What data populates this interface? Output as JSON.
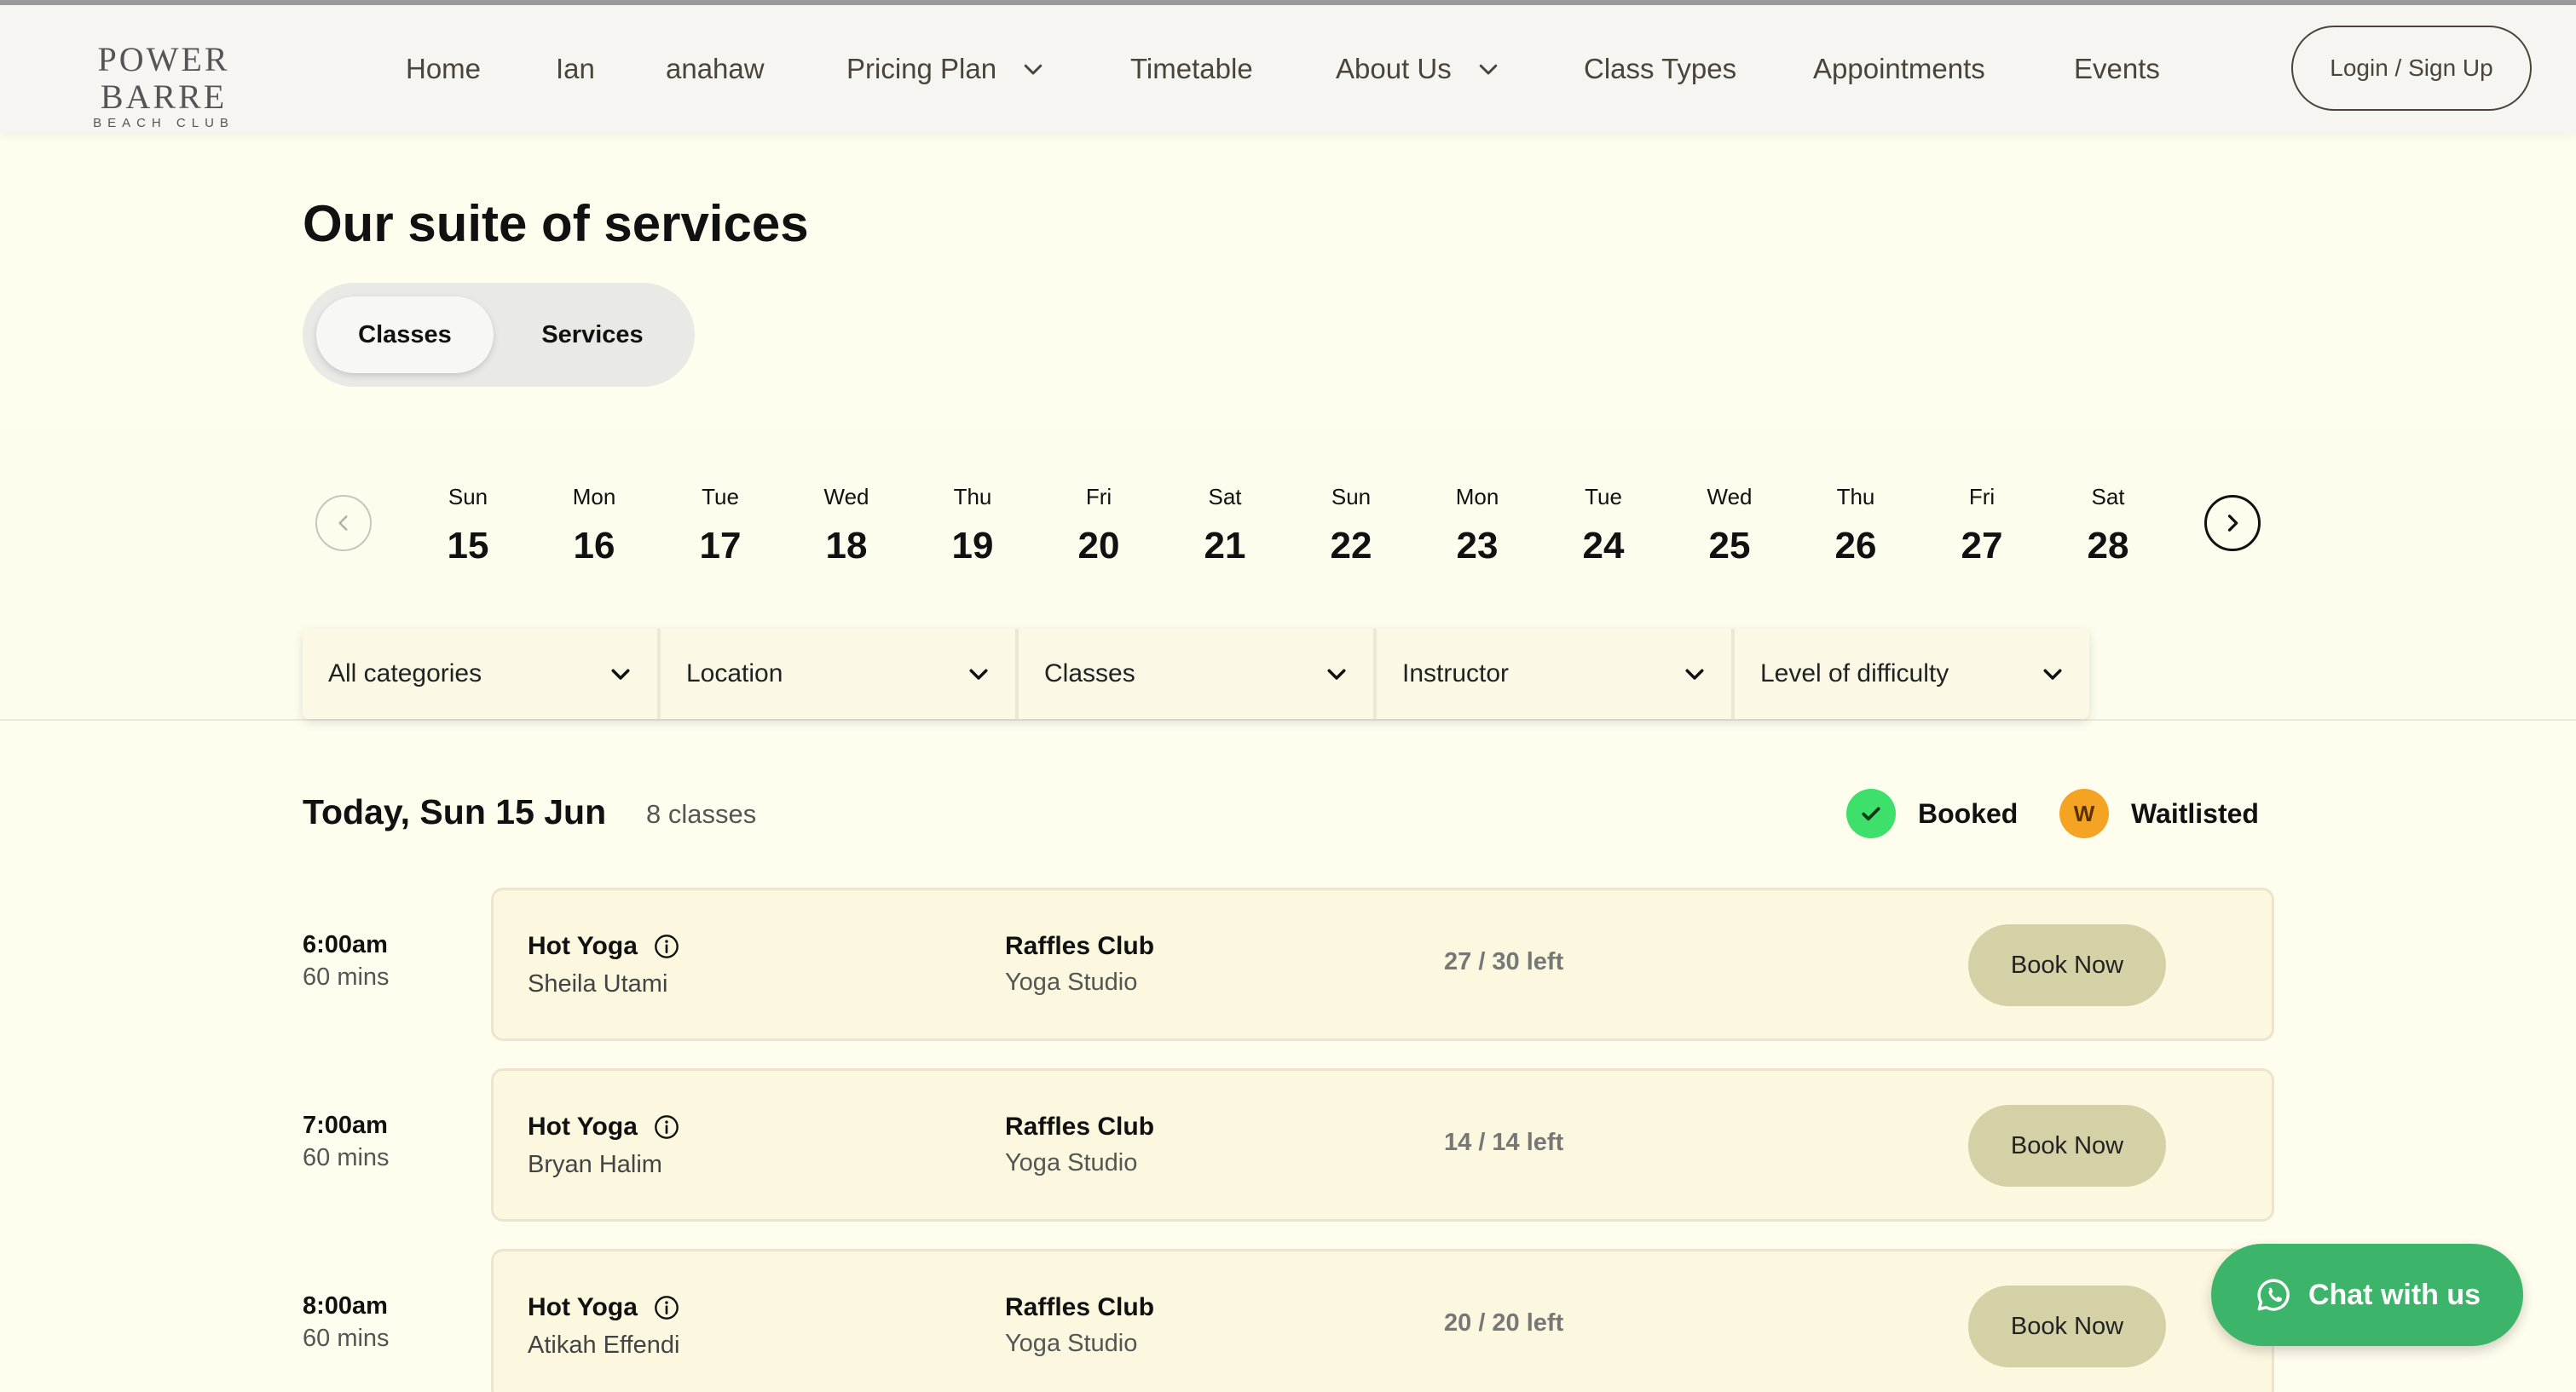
{
  "header": {
    "logo_main": "POWER BARRE",
    "logo_sub": "BEACH CLUB",
    "nav": [
      {
        "label": "Home",
        "dropdown": false
      },
      {
        "label": "Ian",
        "dropdown": false
      },
      {
        "label": "anahaw",
        "dropdown": false
      },
      {
        "label": "Pricing Plan",
        "dropdown": true
      },
      {
        "label": "Timetable",
        "dropdown": false
      },
      {
        "label": "About Us",
        "dropdown": true
      },
      {
        "label": "Class Types",
        "dropdown": false
      },
      {
        "label": "Appointments",
        "dropdown": false
      },
      {
        "label": "Events",
        "dropdown": false
      }
    ],
    "login_label": "Login / Sign Up"
  },
  "page": {
    "title": "Our suite of services",
    "toggle": {
      "active": "Classes",
      "inactive": "Services"
    }
  },
  "dates": [
    {
      "day": "Sun",
      "num": "15"
    },
    {
      "day": "Mon",
      "num": "16"
    },
    {
      "day": "Tue",
      "num": "17"
    },
    {
      "day": "Wed",
      "num": "18"
    },
    {
      "day": "Thu",
      "num": "19"
    },
    {
      "day": "Fri",
      "num": "20"
    },
    {
      "day": "Sat",
      "num": "21"
    },
    {
      "day": "Sun",
      "num": "22"
    },
    {
      "day": "Mon",
      "num": "23"
    },
    {
      "day": "Tue",
      "num": "24"
    },
    {
      "day": "Wed",
      "num": "25"
    },
    {
      "day": "Thu",
      "num": "26"
    },
    {
      "day": "Fri",
      "num": "27"
    },
    {
      "day": "Sat",
      "num": "28"
    }
  ],
  "filters": [
    "All categories",
    "Location",
    "Classes",
    "Instructor",
    "Level of difficulty"
  ],
  "list": {
    "today_label": "Today, Sun 15 Jun",
    "count_label": "8 classes",
    "legend_booked": "Booked",
    "legend_waitlisted": "Waitlisted",
    "waitlist_glyph": "W"
  },
  "classes": [
    {
      "time": "6:00am",
      "duration": "60 mins",
      "name": "Hot Yoga",
      "instructor": "Sheila Utami",
      "location": "Raffles Club",
      "room": "Yoga Studio",
      "spots": "27 / 30 left",
      "action": "Book Now"
    },
    {
      "time": "7:00am",
      "duration": "60 mins",
      "name": "Hot Yoga",
      "instructor": "Bryan Halim",
      "location": "Raffles Club",
      "room": "Yoga Studio",
      "spots": "14 / 14 left",
      "action": "Book Now"
    },
    {
      "time": "8:00am",
      "duration": "60 mins",
      "name": "Hot Yoga",
      "instructor": "Atikah Effendi",
      "location": "Raffles Club",
      "room": "Yoga Studio",
      "spots": "20 / 20 left",
      "action": "Book Now"
    }
  ],
  "chat_label": "Chat with us",
  "colors": {
    "page_bg": "#fefdee",
    "header_bg": "#f6f5f1",
    "card_bg": "#fcf7df",
    "book_button": "#d4d1a6",
    "booked_green": "#3ce06a",
    "waitlist_orange": "#f4a322",
    "chat_green": "#3cb56a"
  }
}
